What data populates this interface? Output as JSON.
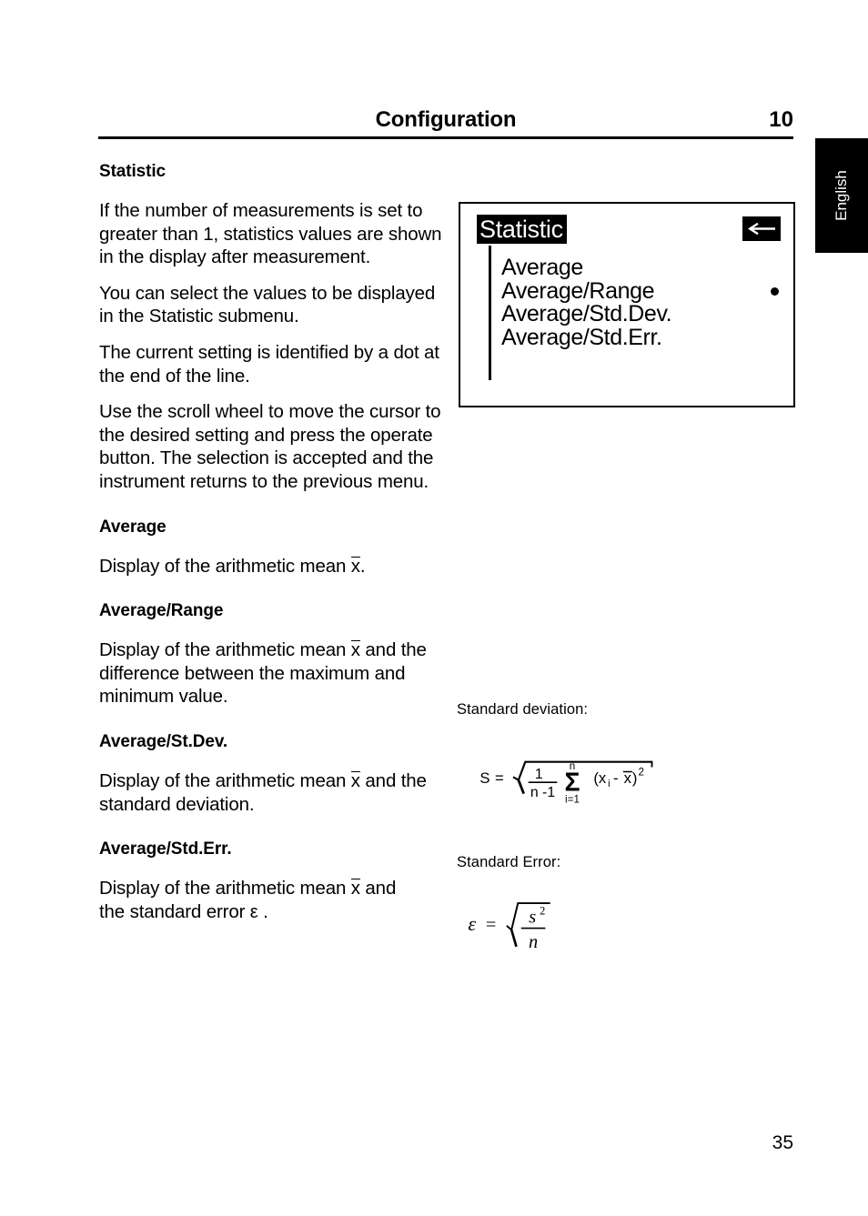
{
  "header": {
    "title": "Configuration",
    "chapter": "10"
  },
  "language_tab": {
    "label": "English"
  },
  "left_column": {
    "section_heading": "Statistic",
    "paragraphs": [
      "If  the number of measurements is set to greater than 1, statistics values are shown in the display after measurement.",
      "You can select the values to be displayed in the Statistic submenu.",
      "The current setting is identified by a dot at the end of the line.",
      "Use the scroll wheel to move the cursor to the desired setting and press the operate button. The selection is accepted and the instrument returns to the previous menu."
    ],
    "subsections": [
      {
        "heading": "Average",
        "body_before": "Display of the arithmetic mean ",
        "symbol": "x",
        "body_after": "."
      },
      {
        "heading": "Average/Range",
        "body_before": "Display of the arithmetic mean ",
        "symbol": "x",
        "body_after": " and the difference between the maximum and minimum value."
      },
      {
        "heading": "Average/St.Dev.",
        "body_before": "Display of the arithmetic mean ",
        "symbol": "x",
        "body_after": " and the standard deviation."
      },
      {
        "heading": "Average/Std.Err.",
        "body_before": "Display of the arithmetic mean ",
        "symbol": "x",
        "body_after": " and",
        "body_line2_before": "the standard error  ",
        "body_line2_symbol": "ε",
        "body_line2_after": " ."
      }
    ]
  },
  "device_display": {
    "title": "Statistic",
    "back_arrow_icon": "arrow-left-icon",
    "menu_items": [
      {
        "label": "Average",
        "selected": false
      },
      {
        "label": "Average/Range",
        "selected": true
      },
      {
        "label": "Average/Std.Dev.",
        "selected": false
      },
      {
        "label": "Average/Std.Err.",
        "selected": false
      }
    ]
  },
  "formulas": {
    "standard_deviation": {
      "caption": "Standard  deviation:",
      "lhs": "S",
      "equals": "=",
      "fraction_numerator": "1",
      "fraction_denominator": "n -1",
      "sum_upper": "n",
      "sum_lower": "i=1",
      "summand_open": "(x",
      "summand_index": "i",
      "summand_minus": "- ",
      "summand_mean": "x",
      "summand_close": ")",
      "summand_power": "2"
    },
    "standard_error": {
      "caption": "Standard  Error:",
      "lhs": "ε",
      "equals": "=",
      "numerator_base": "s",
      "numerator_power": "2",
      "denominator": "n"
    }
  },
  "footer": {
    "page_number": "35"
  }
}
